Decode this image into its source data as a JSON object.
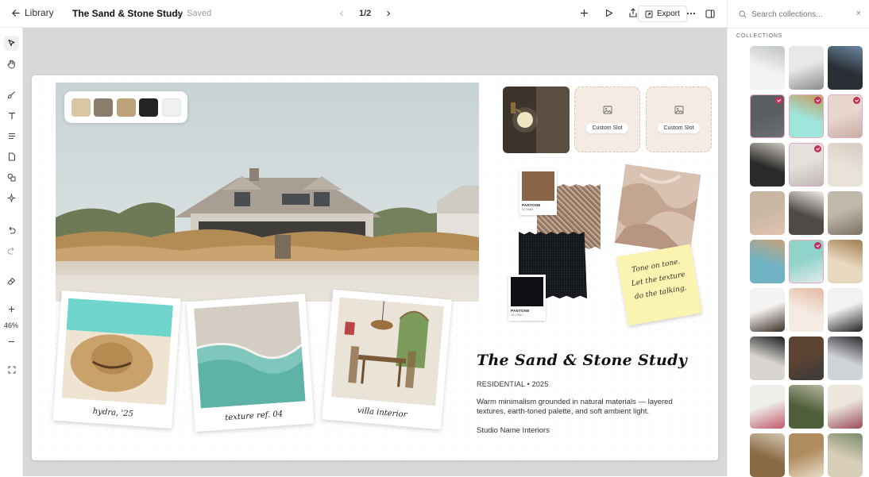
{
  "topbar": {
    "back_label": "Library",
    "doc_title": "The Sand & Stone Study",
    "saved_label": "Saved",
    "page_indicator": "1/2",
    "export_label": "Export"
  },
  "left_tools": {
    "zoom_level": "46%"
  },
  "board": {
    "palette": [
      "#d9c6a4",
      "#8a7d6c",
      "#bea27a",
      "#232325",
      "#eef0f2"
    ],
    "slots": [
      {
        "label": "Custom Slot"
      },
      {
        "label": "Custom Slot"
      }
    ],
    "pantones": [
      {
        "name": "PANTONE",
        "code": "11-5584",
        "color": "#8a6446"
      },
      {
        "name": "PANTONE",
        "code": "15-7980",
        "color": "#0d0f12"
      }
    ],
    "polaroids": [
      {
        "caption": "hydra, '25"
      },
      {
        "caption": "texture ref. 04"
      },
      {
        "caption": "villa interior"
      }
    ],
    "note_lines": [
      "Tone on tone.",
      "Let the texture",
      "do the talking."
    ],
    "project": {
      "title": "The Sand & Stone Study",
      "meta": "RESIDENTIAL • 2025",
      "description": "Warm minimalism grounded in natural materials — layered textures, earth-toned palette, and soft ambient light.",
      "studio": "Studio Name Interiors"
    }
  },
  "sidebar": {
    "search_placeholder": "Search collections...",
    "collections_heading": "COLLECTIONS",
    "thumbnails": [
      {
        "name": "blueprint-sketch",
        "c1": "#f3f3f1",
        "c2": "#bfc3c6",
        "selected": false
      },
      {
        "name": "grey-interior",
        "c1": "#e8e8e8",
        "c2": "#8a8a8a",
        "selected": false
      },
      {
        "name": "dark-frames",
        "c1": "#2a2f36",
        "c2": "#6c8aa2",
        "selected": false
      },
      {
        "name": "slate-wall",
        "c1": "#5a5d62",
        "c2": "#6c6f74",
        "selected": true
      },
      {
        "name": "straw-hat",
        "c1": "#9ee6dc",
        "c2": "#c69a5c",
        "selected": true
      },
      {
        "name": "linen-drape",
        "c1": "#e8d6cf",
        "c2": "#c7ada2",
        "selected": true
      },
      {
        "name": "white-mug",
        "c1": "#2b2a29",
        "c2": "#cfcac3",
        "selected": false
      },
      {
        "name": "cream-fabric",
        "c1": "#e4e0dc",
        "c2": "#bdb7b1",
        "selected": true
      },
      {
        "name": "plaster-wall",
        "c1": "#e9e2d9",
        "c2": "#d6cdc1",
        "selected": false
      },
      {
        "name": "pink-vase",
        "c1": "#c9b7a4",
        "c2": "#e3c2b1",
        "selected": false
      },
      {
        "name": "white-vase",
        "c1": "#4e4a46",
        "c2": "#f1ede8",
        "selected": false
      },
      {
        "name": "ceramic-jars",
        "c1": "#bfb8ab",
        "c2": "#7b6f62",
        "selected": false
      },
      {
        "name": "beach-shore",
        "c1": "#6fb3c4",
        "c2": "#c7a17a",
        "selected": false
      },
      {
        "name": "aqua-wave",
        "c1": "#8fd3cb",
        "c2": "#e7ecea",
        "selected": true
      },
      {
        "name": "wood-chair",
        "c1": "#e8d9bf",
        "c2": "#a27c4e",
        "selected": false
      },
      {
        "name": "windsor-chair",
        "c1": "#f5f3f1",
        "c2": "#3a2f26",
        "selected": false
      },
      {
        "name": "peach-pattern",
        "c1": "#f6ebe3",
        "c2": "#e2b9a3",
        "selected": false
      },
      {
        "name": "zebra-pattern",
        "c1": "#f2f2f2",
        "c2": "#222222",
        "selected": false
      },
      {
        "name": "black-outfit",
        "c1": "#d9d6d2",
        "c2": "#1c1c1c",
        "selected": false
      },
      {
        "name": "brown-top",
        "c1": "#5c4332",
        "c2": "#3a3a3a",
        "selected": false
      },
      {
        "name": "street-walk",
        "c1": "#d0d3d8",
        "c2": "#2b2b2d",
        "selected": false
      },
      {
        "name": "flower-bowl",
        "c1": "#eff0ec",
        "c2": "#c05a6a",
        "selected": false
      },
      {
        "name": "olive-dish",
        "c1": "#4d5e39",
        "c2": "#b8b6a0",
        "selected": false
      },
      {
        "name": "floral-jug",
        "c1": "#ece6dc",
        "c2": "#9a4b5a",
        "selected": false
      },
      {
        "name": "kitchen-shelf",
        "c1": "#8a6a45",
        "c2": "#d4c8b0",
        "selected": false
      },
      {
        "name": "pantry-jars",
        "c1": "#b18c5f",
        "c2": "#e7dcc8",
        "selected": false
      },
      {
        "name": "china-set",
        "c1": "#d8cdb8",
        "c2": "#7a8b6a",
        "selected": false
      }
    ]
  }
}
